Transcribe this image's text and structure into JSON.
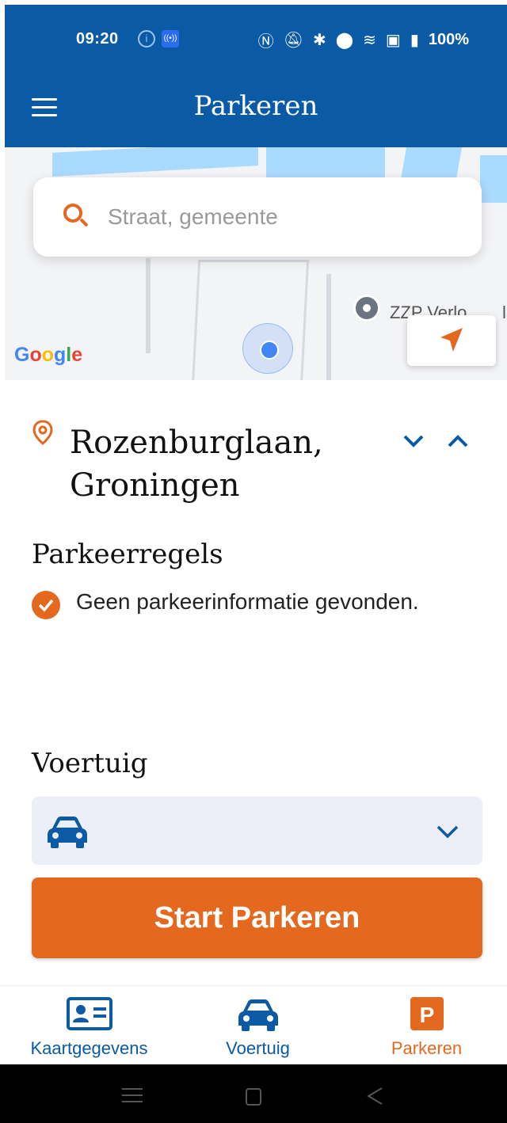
{
  "status_bar": {
    "time": "09:20",
    "battery": "100%",
    "icons": [
      "info-icon",
      "nfc-icon",
      "n-icon",
      "mute-icon",
      "bluetooth-icon",
      "location-icon",
      "wifi-icon",
      "sim-icon",
      "battery-icon"
    ]
  },
  "app_bar": {
    "title": "Parkeren"
  },
  "map": {
    "search_placeholder": "Straat, gemeente",
    "attribution": "Google",
    "poi_label": "ZZP Verlo",
    "poi_label_right": "la"
  },
  "location": {
    "street": "Rozenburglaan,",
    "city": "Groningen"
  },
  "rules": {
    "title": "Parkeerregels",
    "items": [
      "Geen parkeerinformatie gevonden."
    ]
  },
  "vehicle": {
    "title": "Voertuig",
    "selected": ""
  },
  "actions": {
    "start_label": "Start Parkeren"
  },
  "bottom_nav": {
    "items": [
      {
        "label": "Kaartgegevens",
        "icon": "id-card-icon"
      },
      {
        "label": "Voertuig",
        "icon": "car-icon"
      },
      {
        "label": "Parkeren",
        "icon": "parking-icon",
        "active": true
      }
    ]
  },
  "colors": {
    "primary_blue": "#0b5aa6",
    "accent_orange": "#e5681f",
    "select_background": "#eceef8"
  }
}
